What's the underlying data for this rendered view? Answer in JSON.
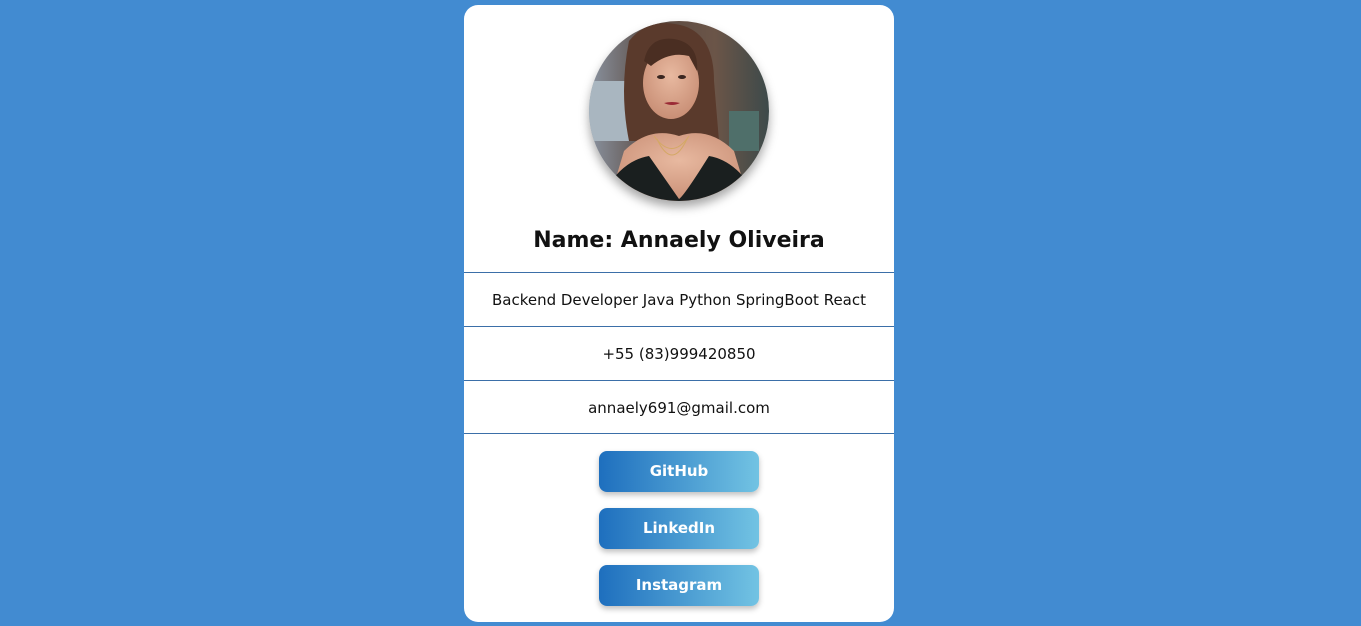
{
  "profile": {
    "name": "Name: Annaely Oliveira",
    "bio": "Backend Developer Java Python SpringBoot React",
    "phone": "+55 (83)999420850",
    "email": "annaely691@gmail.com"
  },
  "links": [
    {
      "label": "GitHub"
    },
    {
      "label": "LinkedIn"
    },
    {
      "label": "Instagram"
    }
  ],
  "colors": {
    "background": "#428bd1",
    "card": "#ffffff",
    "divider": "#3b6fa8",
    "button_gradient_start": "#1e6fbe",
    "button_gradient_end": "#72c3e3"
  }
}
